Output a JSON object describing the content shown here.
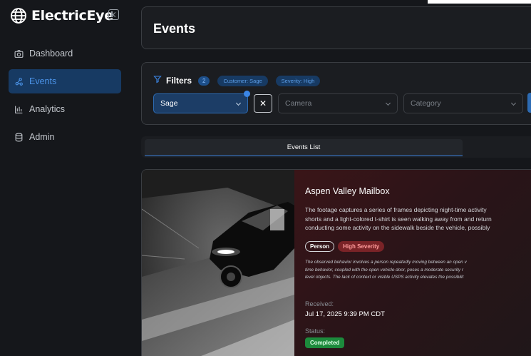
{
  "app": {
    "name": "ElectricEye"
  },
  "sidebar": {
    "items": [
      {
        "label": "Dashboard",
        "icon": "camera-icon",
        "active": false
      },
      {
        "label": "Events",
        "icon": "events-icon",
        "active": true
      },
      {
        "label": "Analytics",
        "icon": "bar-chart-icon",
        "active": false
      },
      {
        "label": "Admin",
        "icon": "database-icon",
        "active": false
      }
    ]
  },
  "header": {
    "title": "Events"
  },
  "filters": {
    "label": "Filters",
    "count": "2",
    "chips": [
      "Customer: Sage",
      "Severity: High"
    ],
    "customer_value": "Sage",
    "clear_label": "✕",
    "camera_placeholder": "Camera",
    "category_placeholder": "Category"
  },
  "tabs": {
    "active_label": "Events List"
  },
  "event": {
    "title": "Aspen Valley Mailbox",
    "description_lines": [
      "The footage captures a series of frames depicting night-time activity",
      "shorts and a light-colored t-shirt is seen walking away from and return",
      "conducting some activity on the sidewalk beside the vehicle, possibly"
    ],
    "tag_person": "Person",
    "tag_severity": "High Severity",
    "analysis_lines": [
      "The observed behavior involves a person repeatedly moving between an open v",
      "time behavior, coupled with the open vehicle door, poses a moderate security r",
      "level objects. The lack of context or visible USPS activity elevates the possibilit"
    ],
    "received_label": "Received:",
    "received_value": "Jul 17, 2025 9:39 PM CDT",
    "status_label": "Status:",
    "status_value": "Completed"
  },
  "colors": {
    "accent": "#3b86e6",
    "severity": "#7a2327",
    "success": "#1c8a3c"
  }
}
